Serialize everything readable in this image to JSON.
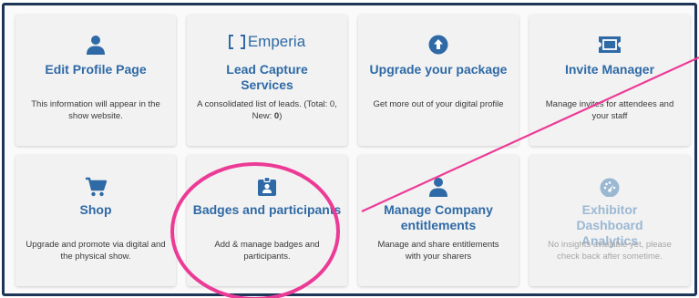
{
  "colors": {
    "accent": "#2f6aa6",
    "disabled_accent": "#9bb8d3",
    "frame_border": "#1d3557",
    "annotation": "#ec3b96"
  },
  "cards": [
    {
      "icon": "person-icon",
      "title": "Edit Profile Page",
      "description": "This information will appear in the show website."
    },
    {
      "icon": "emperia-logo",
      "logo_text": "Emperia",
      "title": "Lead Capture Services",
      "description_prefix": "A consolidated list of leads. (Total: 0, New: ",
      "description_bold": "0",
      "description_suffix": ")"
    },
    {
      "icon": "upload-circle-icon",
      "title": "Upgrade your package",
      "description": "Get more out of your digital profile"
    },
    {
      "icon": "ticket-icon",
      "title": "Invite Manager",
      "description": "Manage invites for attendees and your staff"
    },
    {
      "icon": "cart-icon",
      "title": "Shop",
      "description": "Upgrade and promote via digital and the physical show."
    },
    {
      "icon": "badge-icon",
      "title": "Badges and participants",
      "description": "Add & manage badges and participants."
    },
    {
      "icon": "person-icon",
      "title": "Manage Company entitlements",
      "description": "Manage and share entitlements with your sharers"
    },
    {
      "icon": "speedometer-icon",
      "title": "Exhibitor Dashboard Analytics",
      "description": "No insights available yet, please check back after sometime.",
      "disabled": true
    }
  ]
}
